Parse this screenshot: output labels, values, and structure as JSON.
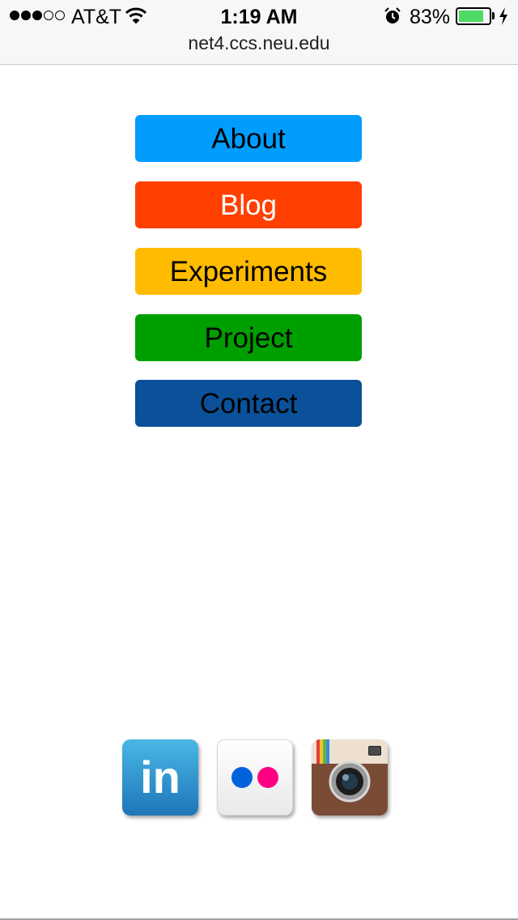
{
  "status_bar": {
    "carrier": "AT&T",
    "time": "1:19 AM",
    "battery_percent": "83%",
    "battery_level": 0.83,
    "signal_bars_filled": 3,
    "signal_bars_total": 5,
    "url": "net4.ccs.neu.edu"
  },
  "nav": {
    "about": "About",
    "blog": "Blog",
    "experiments": "Experiments",
    "project": "Project",
    "contact": "Contact"
  },
  "colors": {
    "about": "#009dff",
    "blog": "#ff4000",
    "experiments": "#ffbb00",
    "project": "#009f00",
    "contact": "#0a519a",
    "battery": "#4cd964"
  },
  "social": {
    "linkedin_text": "in"
  },
  "icons": [
    "wifi-icon",
    "alarm-icon",
    "battery-icon",
    "charging-icon",
    "linkedin-icon",
    "flickr-icon",
    "instagram-icon"
  ]
}
